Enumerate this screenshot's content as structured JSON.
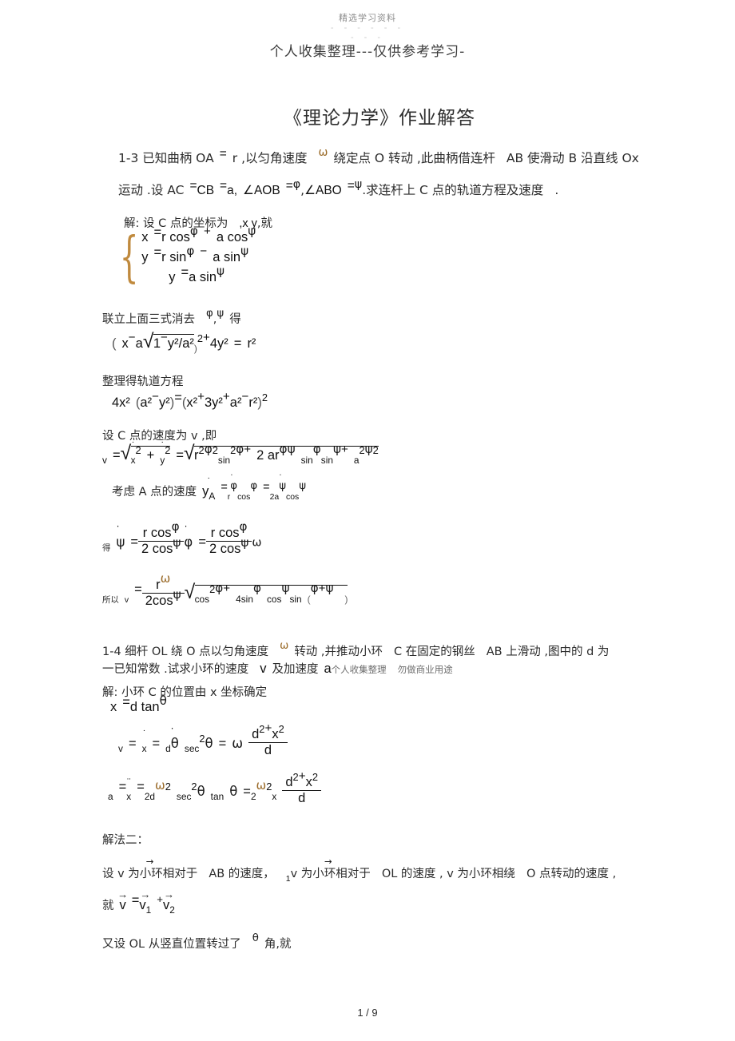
{
  "watermark": {
    "top_small": "精选学习资料",
    "dashes_row1": "- - - - - -",
    "dashes_row2": "- - -",
    "main": "个人收集整理---仅供参考学习-",
    "inline_left": "个人收集整理",
    "inline_right": "勿做商业用途"
  },
  "title": "《理论力学》作业解答",
  "problem_13": {
    "line1_a": "1-3 已知曲柄 OA",
    "line1_eq": "=",
    "line1_b": "r ,以匀角速度",
    "line1_omega": "ω",
    "line1_c": "绕定点 O 转动 ,此曲柄借连杆",
    "line1_d": "AB 使滑动 B 沿直线 Ox",
    "line2_a": "运动 .设 AC",
    "line2_eq1": "=",
    "line2_b": "CB",
    "line2_eq2": "=",
    "line2_c": "a,",
    "line2_ang1": "∠AOB",
    "line2_eq3": "=",
    "line2_phi": "φ",
    "line2_comma": ",",
    "line2_ang2": "∠ABO",
    "line2_eq4": "=",
    "line2_psi": "ψ",
    "line2_d": ".求连杆上 C 点的轨道方程及速度",
    "line2_period": ".",
    "sol_head": "解: 设 C 点的坐标为",
    "sol_head_xy": ",x y",
    "sol_head_tail": ",就",
    "sys_r1_x": "x",
    "sys_r1_eq": "=",
    "sys_r1_rcos": "r cos",
    "sys_r1_phi": "φ",
    "sys_r1_plus": "+",
    "sys_r1_acos": "a cos",
    "sys_r1_psi": "ψ",
    "sys_r2_y": "y",
    "sys_r2_eq": "=",
    "sys_r2_rsin": "r sin",
    "sys_r2_phi": "φ",
    "sys_r2_minus": "−",
    "sys_r2_asin": "a sin",
    "sys_r2_psi": "ψ",
    "sys_r3_y": "y",
    "sys_r3_eq": "=",
    "sys_r3_asin": "a sin",
    "sys_r3_psi": "ψ",
    "elim_text": "联立上面三式消去",
    "elim_phi": "φ",
    "elim_comma": ",",
    "elim_psi": "ψ",
    "elim_de": "得",
    "eq1_open": "(",
    "eq1_x": "x",
    "eq1_minus": "−",
    "eq1_a": "a",
    "eq1_rad_1": "1",
    "eq1_rad_minus": "−",
    "eq1_rad_y2": "y²/a²",
    "eq1_close": ")",
    "eq1_sq": "2",
    "eq1_plus": "+",
    "eq1_4y2": "4y²",
    "eq1_eq": "=",
    "eq1_r2": "r²",
    "tidy_text": "整理得轨道方程",
    "eq2_4x2": "4x²",
    "eq2_open1": "(",
    "eq2_a2": "a²",
    "eq2_minus": "−",
    "eq2_y2": "y²",
    "eq2_close1": ")",
    "eq2_eq": "=",
    "eq2_open2": "(",
    "eq2_x2": "x²",
    "eq2_plus1": "+",
    "eq2_3y2": "3y²",
    "eq2_plus2": "+",
    "eq2_a2b": "a²",
    "eq2_minus2": "−",
    "eq2_r2": "r²",
    "eq2_close2": ")",
    "eq2_sq": "2",
    "vel_head": "设 C 点的速度为 v ,即",
    "v_lhs": "v",
    "v_eq1": "=",
    "v_x": "x",
    "v_sub2a": "2",
    "v_plus": "+",
    "v_y": "y",
    "v_sub2b": "2",
    "v_eq2": "=",
    "v_r2": "r",
    "v_r2sup": "2",
    "v_phi1": "φ",
    "v_phisub": "2",
    "v_sin2": "sin",
    "v_sin2sup": "2",
    "v_phi2": "φ",
    "v_plus2": "+",
    "v_2ar": "2 ar",
    "v_phi3": "φ",
    "v_psi1": "ψ",
    "v_sin3": "sin",
    "v_phi4": "φ",
    "v_sin4": "sin",
    "v_psi2": "ψ",
    "v_plus3": "+",
    "v_a": "a",
    "v_asup": "2",
    "v_psi3": "ψ",
    "v_psisub": "2",
    "ka_head": "考虑 A 点的速度",
    "ka_y": "y",
    "ka_subA": "A",
    "ka_eq1": "=",
    "ka_r": "r",
    "ka_phi1": "φ",
    "ka_cos1": "cos",
    "ka_phi2": "φ",
    "ka_eq2": "=",
    "ka_2a": "2a",
    "ka_psi1": "ψ",
    "ka_cos2": "cos",
    "ka_psi2": "ψ",
    "de_head": "得",
    "de_psi": "ψ",
    "de_eq1": "=",
    "de_num1": "r cos",
    "de_num1_phi": "φ",
    "de_den1": "2 cos",
    "de_den1_psi": "ψ",
    "de_phi": "φ",
    "de_eq2": "=",
    "de_num2": "r cos",
    "de_num2_phi": "φ",
    "de_den2": "2 cos",
    "de_den2_psi": "ψ",
    "de_omega": "ω",
    "so_head": "所以",
    "so_v": "v",
    "so_eq": "=",
    "so_num_r": "r",
    "so_num_omega": "ω",
    "so_den": "2cos",
    "so_den_psi": "ψ",
    "so_cos": "cos",
    "so_cos_sup": "2",
    "so_phi1": "φ",
    "so_plus": "+",
    "so_4sin": "4sin",
    "so_phi2": "φ",
    "so_cos2": "cos",
    "so_psi1": "ψ",
    "so_sin": "sin",
    "so_open": "(",
    "so_phi3": "φ",
    "so_plus2": "+",
    "so_psi2": "ψ",
    "so_close": ")"
  },
  "problem_14": {
    "line1_a": "1-4 细杆 OL 绕 O 点以匀角速度",
    "line1_omega": "ω",
    "line1_b": "转动 ,并推动小环",
    "line1_c": "C 在固定的钢丝",
    "line1_d": "AB 上滑动 ,图中的 d 为",
    "line2_a": "一已知常数 .试求小环的速度",
    "line2_v": "v",
    "line2_b": "及加速度",
    "line2_acc": "a",
    "sol_head": "解: 小环 C 的位置由 x 坐标确定",
    "xeq_x": "x",
    "xeq_eq": "=",
    "xeq_dtan": "d tan",
    "xeq_theta": "θ",
    "veq_v": "v",
    "veq_eq1": "=",
    "veq_x": "x",
    "veq_eq2": "=",
    "veq_d": "d",
    "veq_theta1": "θ",
    "veq_sec": "sec",
    "veq_sec_sup": "2",
    "veq_theta2": "θ",
    "veq_eq3": "=",
    "veq_omega": "ω",
    "veq_num": "d",
    "veq_num_sup": "2",
    "veq_num_plus": "+",
    "veq_num_x": "x",
    "veq_num_x_sup": "2",
    "veq_den": "d",
    "aeq_a": "a",
    "aeq_eq1": "=",
    "aeq_x": "x",
    "aeq_eq2": "=",
    "aeq_2d": "2d",
    "aeq_omega": "ω",
    "aeq_omega_sup": "2",
    "aeq_sec": "sec",
    "aeq_sec_sup": "2",
    "aeq_theta1": "θ",
    "aeq_tan": "tan",
    "aeq_theta2": "θ",
    "aeq_eq3": "=",
    "aeq_2": "2",
    "aeq_omega2": "ω",
    "aeq_omega2_sup": "2",
    "aeq_x2": "x",
    "aeq_num": "d",
    "aeq_num_sup": "2",
    "aeq_num_plus": "+",
    "aeq_num_x": "x",
    "aeq_num_x_sup": "2",
    "aeq_den": "d",
    "alt_head": "解法二：",
    "alt_l1_a": "设 v 为小环相对于",
    "alt_l1_b": "AB 的速度，",
    "alt_l1_c": "v 为小环相对于",
    "alt_l1_c_sub": "1",
    "alt_l1_d": "OL 的速度 , v 为小环相绕",
    "alt_l1_e": "O 点转动的速度 ,",
    "alt_l2_head": "就",
    "alt_l2_v": "v",
    "alt_l2_eq": "=",
    "alt_l2_v1": "v",
    "alt_l2_v1sub": "1",
    "alt_l2_plus": "+",
    "alt_l2_v2": "v",
    "alt_l2_v2sub": "2",
    "alt_l3_a": "又设 OL 从竖直位置转过了",
    "alt_l3_theta": "θ",
    "alt_l3_b": "角,就"
  },
  "footer": {
    "page": "1 / 9"
  }
}
